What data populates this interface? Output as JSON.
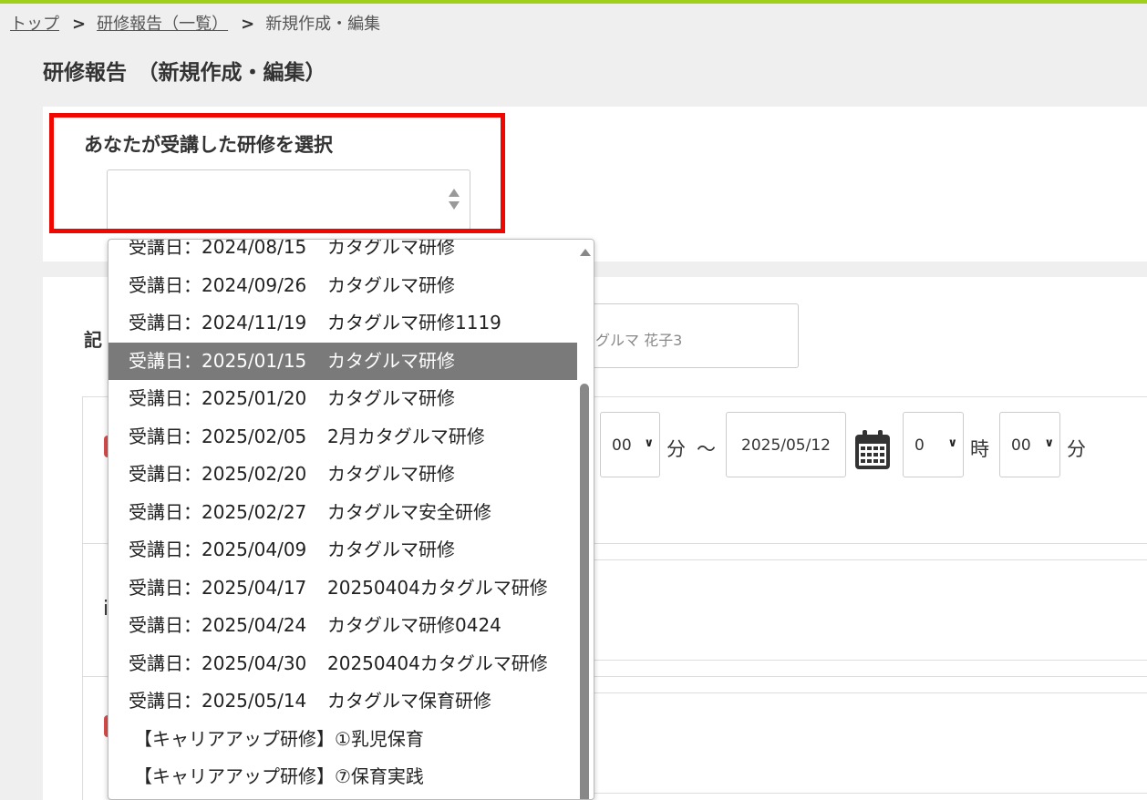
{
  "breadcrumb": {
    "items": [
      "トップ",
      "研修報告（一覧）",
      "新規作成・編集"
    ],
    "separator": ">"
  },
  "page_title": "研修報告　（新規作成・編集）",
  "training_select": {
    "label": "あなたが受講した研修を選択",
    "value": ""
  },
  "form": {
    "label_fragment": "記",
    "author_name_fragment": "グルマ 花子3",
    "side_text_fragment": "i",
    "time_range": {
      "start_minute": "00",
      "minute_unit": "分",
      "range_sep": "～",
      "end_date": "2025/05/12",
      "end_hour": "0",
      "hour_unit": "時",
      "end_minute": "00"
    }
  },
  "dropdown": {
    "selected_index": 3,
    "options": [
      {
        "date": "受講日：2024/08/15",
        "name": "カタグルマ研修"
      },
      {
        "date": "受講日：2024/09/26",
        "name": "カタグルマ研修"
      },
      {
        "date": "受講日：2024/11/19",
        "name": "カタグルマ研修1119"
      },
      {
        "date": "受講日：2025/01/15",
        "name": "カタグルマ研修"
      },
      {
        "date": "受講日：2025/01/20",
        "name": "カタグルマ研修"
      },
      {
        "date": "受講日：2025/02/05",
        "name": "2月カタグルマ研修"
      },
      {
        "date": "受講日：2025/02/20",
        "name": "カタグルマ研修"
      },
      {
        "date": "受講日：2025/02/27",
        "name": "カタグルマ安全研修"
      },
      {
        "date": "受講日：2025/04/09",
        "name": "カタグルマ研修"
      },
      {
        "date": "受講日：2025/04/17",
        "name": "20250404カタグルマ研修"
      },
      {
        "date": "受講日：2025/04/24",
        "name": "カタグルマ研修0424"
      },
      {
        "date": "受講日：2025/04/30",
        "name": "20250404カタグルマ研修"
      },
      {
        "date": "受講日：2025/05/14",
        "name": "カタグルマ保育研修"
      },
      {
        "date": "",
        "name": "【キャリアアップ研修】①乳児保育"
      },
      {
        "date": "",
        "name": "【キャリアアップ研修】⑦保育実践"
      }
    ]
  },
  "colors": {
    "accent_bar": "#a0cf1e",
    "highlight": "#f00800",
    "selected_option": "#7a7a7a",
    "required_mark": "#d94c4c"
  }
}
